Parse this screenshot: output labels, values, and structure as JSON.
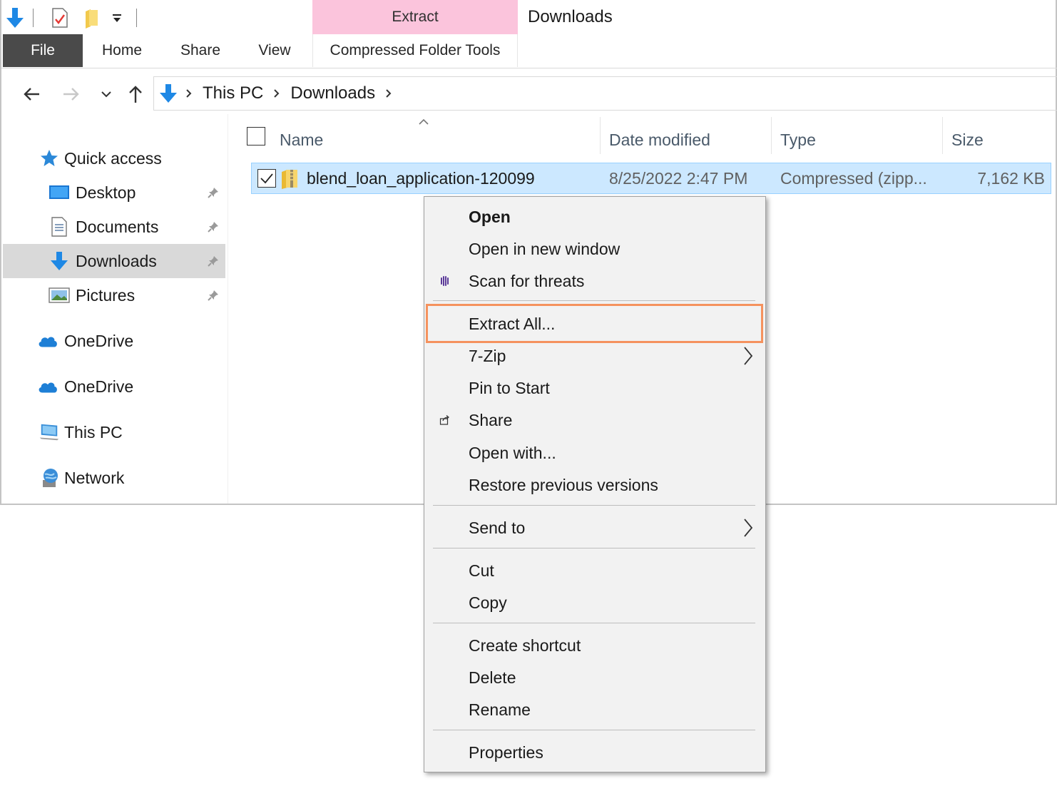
{
  "ribbon": {
    "context_group": "Extract",
    "window_title": "Downloads",
    "tabs": {
      "file": "File",
      "home": "Home",
      "share": "Share",
      "view": "View",
      "compressed": "Compressed Folder Tools"
    }
  },
  "address": {
    "crumbs": [
      "This PC",
      "Downloads"
    ]
  },
  "sidebar": {
    "quick_access": "Quick access",
    "desktop": "Desktop",
    "documents": "Documents",
    "downloads": "Downloads",
    "pictures": "Pictures",
    "onedrive_1": "OneDrive",
    "onedrive_2": "OneDrive",
    "this_pc": "This PC",
    "network": "Network"
  },
  "columns": {
    "name": "Name",
    "date": "Date modified",
    "type": "Type",
    "size": "Size"
  },
  "file": {
    "name": "blend_loan_application-120099",
    "date": "8/25/2022 2:47 PM",
    "type": "Compressed (zipp...",
    "size": "7,162 KB"
  },
  "menu": {
    "open": "Open",
    "open_new_window": "Open in new window",
    "scan": "Scan for threats",
    "extract_all": "Extract All...",
    "seven_zip": "7-Zip",
    "pin_start": "Pin to Start",
    "share": "Share",
    "open_with": "Open with...",
    "restore": "Restore previous versions",
    "send_to": "Send to",
    "cut": "Cut",
    "copy": "Copy",
    "create_shortcut": "Create shortcut",
    "delete": "Delete",
    "rename": "Rename",
    "properties": "Properties"
  },
  "colors": {
    "context_tab": "#fbc4dc",
    "file_tab": "#4a4a4a",
    "selection": "#cce8ff",
    "highlight_box": "#f5925e",
    "accent": "#1e88e5"
  }
}
